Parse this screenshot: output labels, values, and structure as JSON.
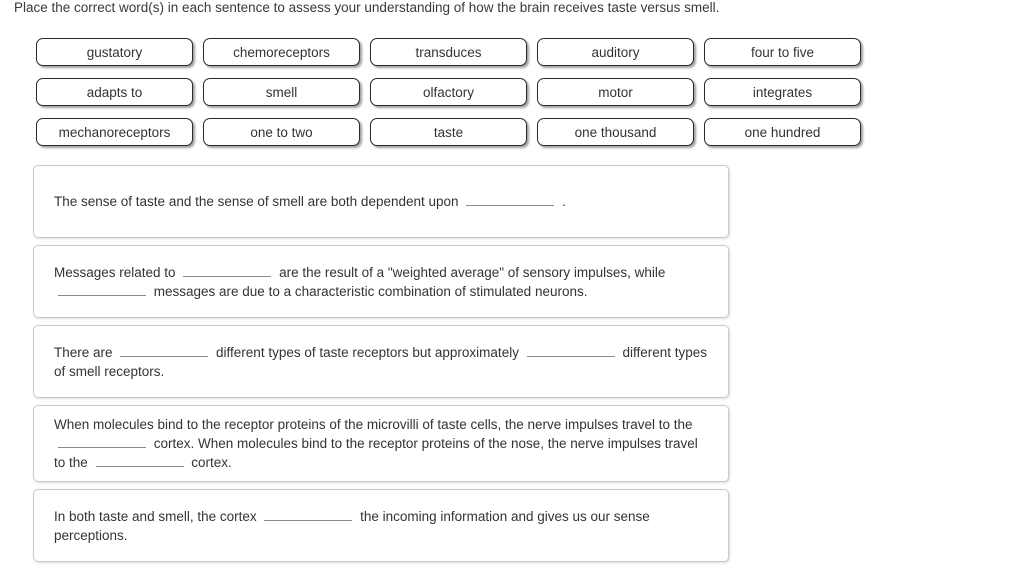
{
  "instruction": "Place the correct word(s) in each sentence to assess your understanding of how the brain receives taste versus smell.",
  "word_bank": {
    "rows": [
      [
        {
          "label": "gustatory"
        },
        {
          "label": "chemoreceptors"
        },
        {
          "label": "transduces"
        },
        {
          "label": "auditory"
        },
        {
          "label": "four to five"
        }
      ],
      [
        {
          "label": "adapts to"
        },
        {
          "label": "smell"
        },
        {
          "label": "olfactory"
        },
        {
          "label": "motor"
        },
        {
          "label": "integrates"
        }
      ],
      [
        {
          "label": "mechanoreceptors"
        },
        {
          "label": "one to two"
        },
        {
          "label": "taste"
        },
        {
          "label": "one thousand"
        },
        {
          "label": "one hundred"
        }
      ]
    ]
  },
  "sentences": [
    {
      "id": "sentence-1",
      "parts": [
        {
          "type": "text",
          "value": "The sense of taste and the sense of smell are both dependent upon "
        },
        {
          "type": "blank"
        },
        {
          "type": "text",
          "value": " ."
        }
      ]
    },
    {
      "id": "sentence-2",
      "parts": [
        {
          "type": "text",
          "value": "Messages related to "
        },
        {
          "type": "blank"
        },
        {
          "type": "text",
          "value": " are the result of a \"weighted average\" of sensory impulses, while "
        },
        {
          "type": "blank"
        },
        {
          "type": "text",
          "value": " messages are due to a characteristic combination of stimulated neurons."
        }
      ]
    },
    {
      "id": "sentence-3",
      "parts": [
        {
          "type": "text",
          "value": "There are "
        },
        {
          "type": "blank"
        },
        {
          "type": "text",
          "value": " different types of taste receptors but approximately "
        },
        {
          "type": "blank"
        },
        {
          "type": "text",
          "value": " different types of smell receptors."
        }
      ]
    },
    {
      "id": "sentence-4",
      "parts": [
        {
          "type": "text",
          "value": "When molecules bind to the receptor proteins of the microvilli of taste cells, the nerve impulses travel to the "
        },
        {
          "type": "blank"
        },
        {
          "type": "text",
          "value": " cortex. When molecules bind to the receptor proteins of the nose, the nerve impulses travel to the "
        },
        {
          "type": "blank"
        },
        {
          "type": "text",
          "value": " cortex."
        }
      ]
    },
    {
      "id": "sentence-5",
      "parts": [
        {
          "type": "text",
          "value": "In both taste and smell, the cortex "
        },
        {
          "type": "blank"
        },
        {
          "type": "text",
          "value": " the incoming information and gives us our sense perceptions."
        }
      ]
    }
  ],
  "colors": {
    "text": "#333333",
    "chip_border": "#2b2b2b",
    "box_border": "#c9c9c9",
    "blank_line": "#8a8a8a",
    "background": "#ffffff"
  }
}
